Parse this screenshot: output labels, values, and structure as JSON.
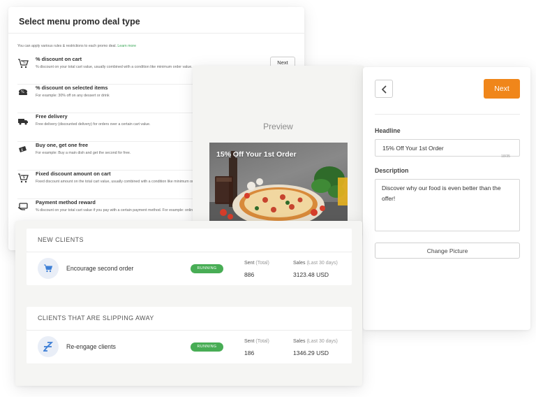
{
  "promo": {
    "title": "Select menu promo deal type",
    "note": "You can apply various rules & restrictions to each promo deal.",
    "learn_more": "Learn more",
    "next_label": "Next",
    "items": [
      {
        "name": "% discount on cart",
        "desc": "% discount on your total cart value, usually combined with a condition like minimum order value.",
        "icon": "cart-percent-icon"
      },
      {
        "name": "% discount on selected items",
        "desc": "For example: 30% off on any dessert or drink",
        "icon": "food-items-icon"
      },
      {
        "name": "Free delivery",
        "desc": "Free delivery (discounted delivery) for orders over a certain cart value.",
        "icon": "delivery-truck-icon"
      },
      {
        "name": "Buy one, get one free",
        "desc": "For example: Buy a main dish and get the second for free.",
        "icon": "ticket-icon"
      },
      {
        "name": "Fixed discount amount on cart",
        "desc": "Fixed discount amount on the total cart value, usually combined with a condition like minimum order value.",
        "icon": "cart-dollar-icon"
      },
      {
        "name": "Payment method reward",
        "desc": "% discount on your total cart value if you pay with a certain payment method. For example: online payment.",
        "icon": "payment-card-icon"
      }
    ]
  },
  "preview": {
    "title": "Preview",
    "image_headline": "15% Off Your 1st Order"
  },
  "editor": {
    "next_label": "Next",
    "headline_label": "Headline",
    "headline_value": "15% Off Your 1st Order",
    "headline_count": "18/35",
    "description_label": "Description",
    "description_value": "Discover why our food is even better than the offer!",
    "change_picture_label": "Change Picture",
    "accent_color": "#f0861a"
  },
  "campaigns": {
    "segments": [
      {
        "title": "NEW CLIENTS",
        "campaign": "Encourage second order",
        "status": "RUNNING",
        "sent_label": "Sent",
        "sent_note": "(Total)",
        "sent_value": "886",
        "sales_label": "Sales",
        "sales_note": "(Last 30 days)",
        "sales_value": "3123.48 USD",
        "icon": "cart-icon"
      },
      {
        "title": "CLIENTS THAT ARE SLIPPING AWAY",
        "campaign": "Re-engage clients",
        "status": "RUNNING",
        "sent_label": "Sent",
        "sent_note": "(Total)",
        "sent_value": "186",
        "sales_label": "Sales",
        "sales_note": "(Last 30 days)",
        "sales_value": "1346.29 USD",
        "icon": "sleep-icon"
      }
    ],
    "status_color": "#48ad55"
  }
}
